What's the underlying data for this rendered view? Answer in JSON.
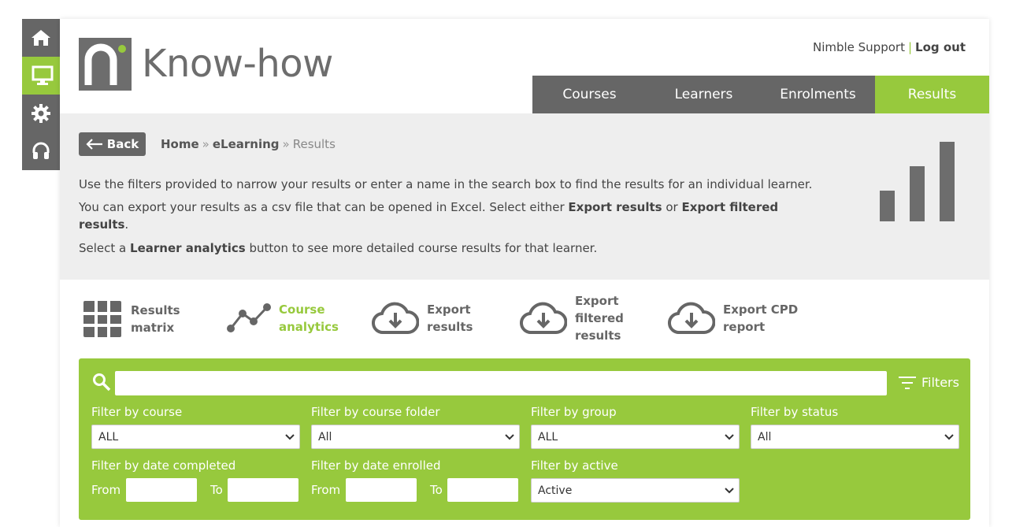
{
  "sidenav": {
    "items": [
      {
        "icon": "home-icon"
      },
      {
        "icon": "monitor-icon"
      },
      {
        "icon": "gear-icon"
      },
      {
        "icon": "headset-icon"
      }
    ]
  },
  "logo": {
    "text": "Know-how"
  },
  "header": {
    "support": "Nimble Support",
    "separator": "|",
    "logout": "Log out"
  },
  "nav": {
    "tabs": [
      "Courses",
      "Learners",
      "Enrolments",
      "Results"
    ],
    "active": "Results"
  },
  "intro": {
    "back": "Back",
    "breadcrumb": {
      "home": "Home",
      "sep": "»",
      "elearning": "eLearning",
      "current": "Results"
    },
    "line1": "Use the filters provided to narrow your results or enter a name in the search box to find the results for an individual learner.",
    "line2_pre": "You can export your results as a csv file that can be opened in Excel. Select either ",
    "line2_b1": "Export results",
    "line2_mid": " or ",
    "line2_b2": "Export filtered results",
    "line2_post": ".",
    "line3_pre": "Select a ",
    "line3_b": "Learner analytics",
    "line3_post": " button to see more detailed course results for that learner."
  },
  "actions": {
    "matrix": [
      "Results",
      "matrix"
    ],
    "analytics": [
      "Course",
      "analytics"
    ],
    "export": [
      "Export",
      "results"
    ],
    "export_filtered": [
      "Export",
      "filtered",
      "results"
    ],
    "export_cpd": [
      "Export CPD",
      "report"
    ]
  },
  "filters": {
    "search_value": "",
    "button": "Filters",
    "course_label": "Filter by course",
    "course_value": "ALL",
    "folder_label": "Filter by course folder",
    "folder_value": "All",
    "group_label": "Filter by group",
    "group_value": "ALL",
    "status_label": "Filter by status",
    "status_value": "All",
    "completed_label": "Filter by date completed",
    "enrolled_label": "Filter by date enrolled",
    "active_label": "Filter by active",
    "active_value": "Active",
    "from": "From",
    "to": "To"
  },
  "colors": {
    "green": "#97c93d",
    "grey": "#666666",
    "light": "#eeeeee"
  }
}
